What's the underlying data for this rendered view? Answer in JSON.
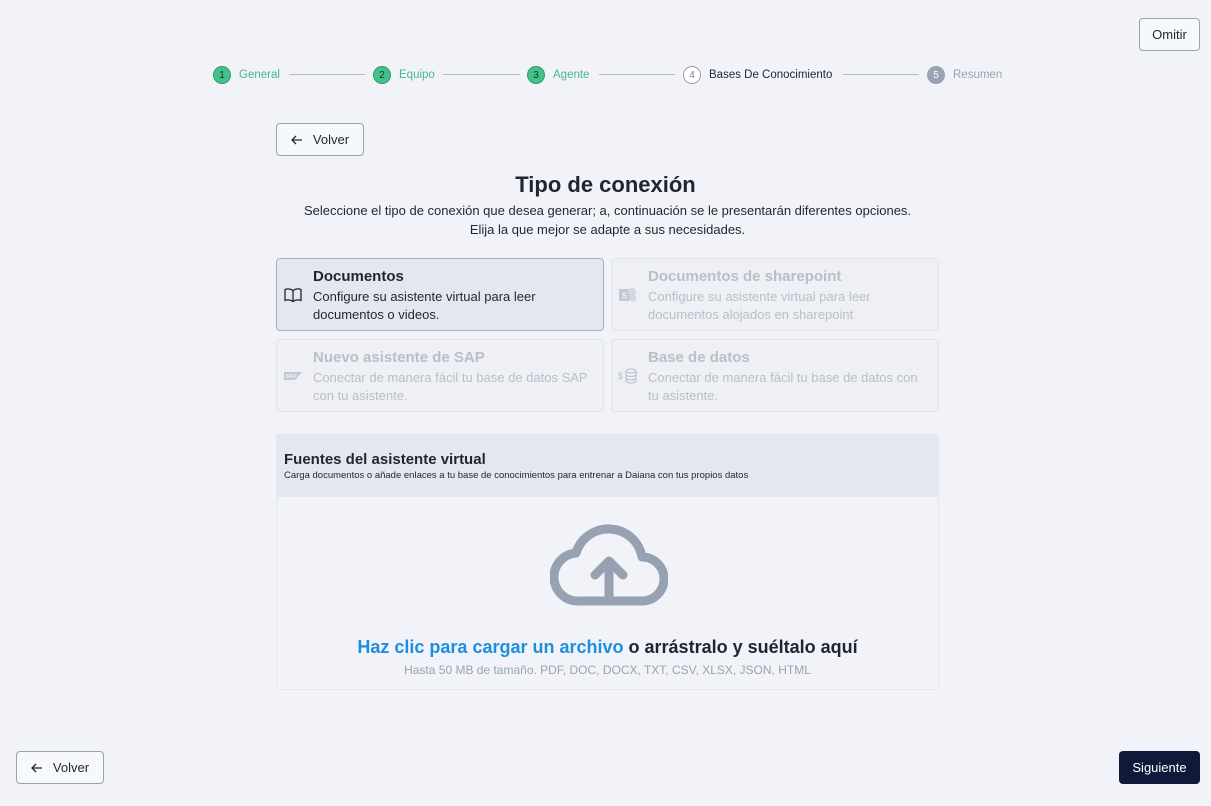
{
  "header": {
    "skip_label": "Omitir"
  },
  "stepper": {
    "steps": [
      {
        "number": "1",
        "label": "General",
        "state": "done"
      },
      {
        "number": "2",
        "label": "Equipo",
        "state": "done"
      },
      {
        "number": "3",
        "label": "Agente",
        "state": "done"
      },
      {
        "number": "4",
        "label": "Bases De Conocimiento",
        "state": "current"
      },
      {
        "number": "5",
        "label": "Resumen",
        "state": "future"
      }
    ]
  },
  "back_top_label": "Volver",
  "main": {
    "title": "Tipo de conexión",
    "subtitle_line1": "Seleccione el tipo de conexión que desea generar; a, continuación se le presentarán diferentes opciones.",
    "subtitle_line2": "Elija la que mejor se adapte a sus necesidades."
  },
  "cards": [
    {
      "title": "Documentos",
      "description": "Configure su asistente virtual para leer documentos o videos.",
      "icon": "book-icon",
      "selected": true,
      "disabled": false
    },
    {
      "title": "Documentos de sharepoint",
      "description": "Configure su asistente virtual para leer documentos alojados en sharepoint",
      "icon": "sharepoint-icon",
      "selected": false,
      "disabled": true
    },
    {
      "title": "Nuevo asistente de SAP",
      "description": "Conectar de manera fácil tu base de datos SAP con tu asistente.",
      "icon": "sap-icon",
      "selected": false,
      "disabled": true
    },
    {
      "title": "Base de datos",
      "description": "Conectar de manera fácil tu base de datos con tu asistente.",
      "icon": "database-icon",
      "selected": false,
      "disabled": true
    }
  ],
  "sources": {
    "title": "Fuentes del asistente virtual",
    "subtitle": "Carga documentos o añade enlaces a tu base de conocimientos para entrenar a Daiana con tus propios datos",
    "upload_link": "Haz clic para cargar un archivo",
    "upload_rest": "o arrástralo y suéltalo aquí",
    "upload_hint": "Hasta 50 MB de tamaño. PDF, DOC, DOCX, TXT, CSV, XLSX, JSON, HTML"
  },
  "footer": {
    "back_label": "Volver",
    "next_label": "Siguiente"
  },
  "colors": {
    "done": "#44c08a",
    "accent_link": "#1d8fe0",
    "primary_button": "#0f1a3a"
  }
}
